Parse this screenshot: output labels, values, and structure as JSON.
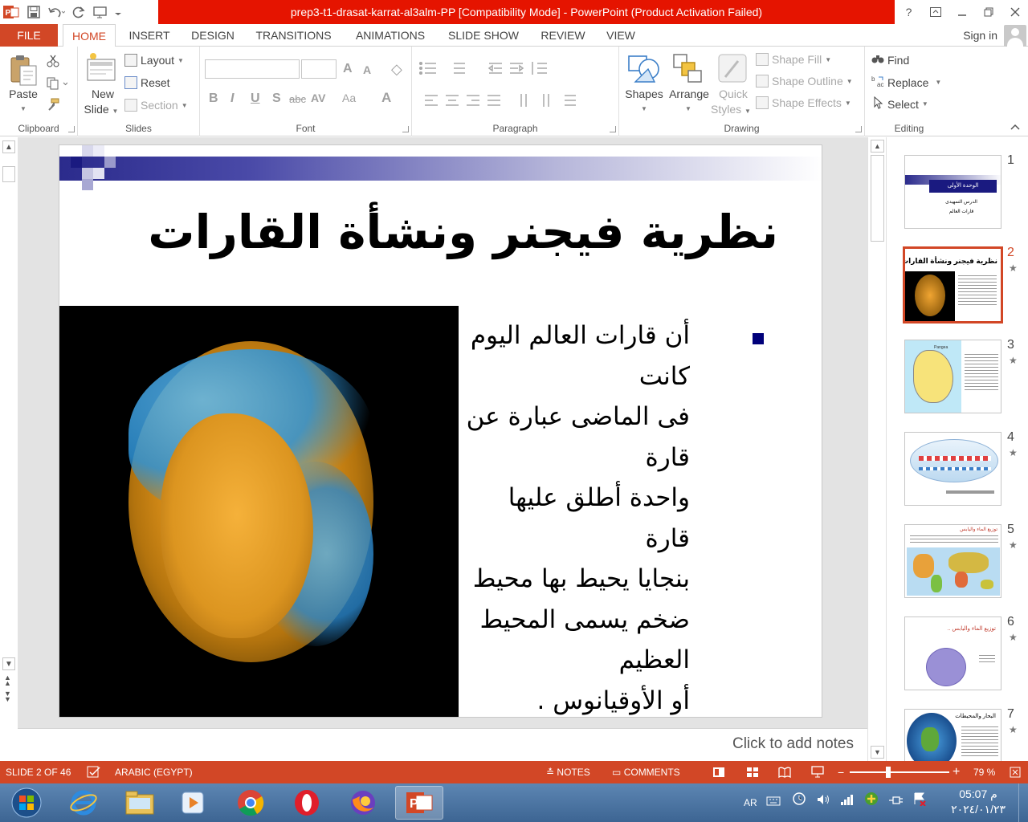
{
  "window": {
    "title": "prep3-t1-drasat-karrat-al3alm-PP [Compatibility Mode] -  PowerPoint (Product Activation Failed)",
    "help": "?",
    "accent": "#d24726",
    "title_bg": "#e51400"
  },
  "tabs": {
    "file": "FILE",
    "home": "HOME",
    "insert": "INSERT",
    "design": "DESIGN",
    "transitions": "TRANSITIONS",
    "animations": "ANIMATIONS",
    "slideshow": "SLIDE SHOW",
    "review": "REVIEW",
    "view": "VIEW",
    "signin": "Sign in"
  },
  "ribbon": {
    "clipboard": {
      "label": "Clipboard",
      "paste": "Paste"
    },
    "slides": {
      "label": "Slides",
      "new_slide_1": "New",
      "new_slide_2": "Slide",
      "layout": "Layout",
      "reset": "Reset",
      "section": "Section"
    },
    "font": {
      "label": "Font",
      "bold": "B",
      "italic": "I",
      "underline": "U",
      "shadow": "S",
      "strike": "abc",
      "spacing": "AV",
      "case": "Aa",
      "color": "A",
      "grow": "A",
      "shrink": "A"
    },
    "paragraph": {
      "label": "Paragraph"
    },
    "drawing": {
      "label": "Drawing",
      "shapes": "Shapes",
      "arrange": "Arrange",
      "quick_styles_1": "Quick",
      "quick_styles_2": "Styles",
      "shape_fill": "Shape Fill",
      "shape_outline": "Shape Outline",
      "shape_effects": "Shape Effects"
    },
    "editing": {
      "label": "Editing",
      "find": "Find",
      "replace": "Replace",
      "select": "Select"
    }
  },
  "slide": {
    "title": "نظرية فيجنر ونشأة القارات",
    "bullet_lines": [
      "أن قارات العالم اليوم كانت",
      "فى الماضى عبارة عن قارة",
      "واحدة أطلق عليها قارة",
      "بنجايا يحيط بها محيط",
      "ضخم يسمى المحيط العظيم",
      "أو الأوقيانوس ."
    ]
  },
  "notes": {
    "placeholder": "Click to add notes"
  },
  "thumbnails": {
    "numbers": [
      "1",
      "2",
      "3",
      "4",
      "5",
      "6",
      "7"
    ],
    "star": "★",
    "t1": {
      "l1": "الوحدة الأولى",
      "l2": "الدرس التمهيدى",
      "l3": "قارات العالم"
    },
    "t2": {
      "title": "نظرية فيجنر ونشأة القارات"
    },
    "t3": {
      "label": "Pangea"
    },
    "t5": {
      "title": "توزيع الماء واليابس"
    },
    "t6": {
      "title": "توزيع الماء واليابس .."
    },
    "t7": {
      "title": "البحار والمحيطات"
    }
  },
  "status": {
    "slide": "SLIDE 2 OF 46",
    "language": "ARABIC (EGYPT)",
    "notes": "NOTES",
    "comments": "COMMENTS",
    "zoom_minus": "−",
    "zoom_plus": "+",
    "zoom": "79 %"
  },
  "taskbar": {
    "lang": "AR",
    "time": "05:07 م",
    "date": "٢٠٢٤/٠١/٢٣"
  }
}
